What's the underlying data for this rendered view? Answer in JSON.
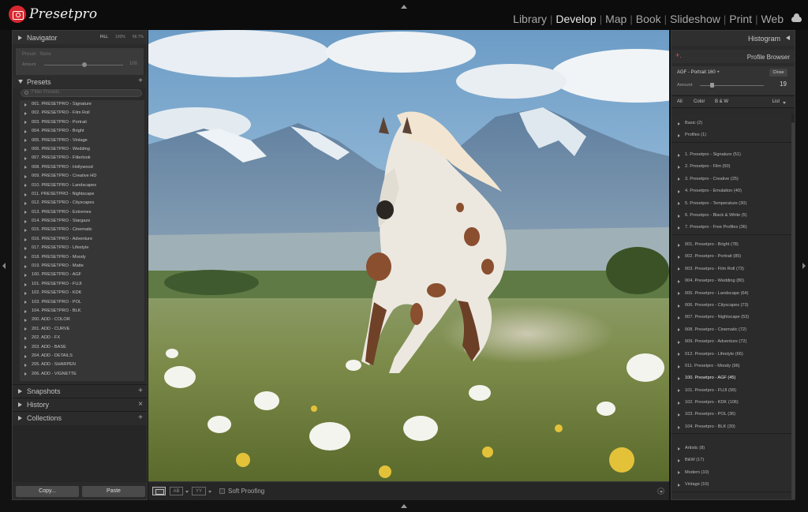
{
  "app": {
    "name": "Presetpro",
    "modules": [
      "Library",
      "Develop",
      "Map",
      "Book",
      "Slideshow",
      "Print",
      "Web"
    ],
    "active_module": "Develop",
    "accent": "#d8282f"
  },
  "navigator": {
    "title": "Navigator",
    "zoom": [
      "FILL",
      "100%",
      "66.7%"
    ],
    "active_zoom": "FILL",
    "preset_text": "Preset : None",
    "amount_label": "Amount",
    "amount_value": "100"
  },
  "presets": {
    "title": "Presets",
    "filter_placeholder": "Filter Presets",
    "items": [
      "001. PRESETPRO - Signature",
      "002. PRESETPRO - Film Roll",
      "003. PRESETPRO - Portrait",
      "004. PRESETPRO - Bright",
      "005. PRESETPRO - Vintage",
      "006. PRESETPRO - Wedding",
      "007. PRESETPRO - Filterlook",
      "008. PRESETPRO - Hollywood",
      "009. PRESETPRO - Creative HD",
      "010. PRESETPRO - Landscapes",
      "011. PRESETPRO - Nightscape",
      "012. PRESETPRO - Cityscapes",
      "013. PRESETPRO - Extremes",
      "014. PRESETPRO - Stargaze",
      "015. PRESETPRO - Cinematic",
      "016. PRESETPRO - Adventure",
      "017. PRESETPRO - Lifestyle",
      "018. PRESETPRO - Moody",
      "019. PRESETPRO - Matte",
      "100. PRESETPRO - AGF",
      "101. PRESETPRO - FUJI",
      "102. PRESETPRO - KDK",
      "103. PRESETPRO - POL",
      "104. PRESETPRO - BLK",
      "200. ADD - COLOR",
      "201. ADD - CURVE",
      "202. ADD - FX",
      "203. ADD - BASE",
      "204. ADD - DETAILS",
      "205. ADD - SHARPEN",
      "206. ADD - VIGNETTE"
    ]
  },
  "left_sections": {
    "snapshots": "Snapshots",
    "history": "History",
    "collections": "Collections",
    "plus": "+",
    "close": "×"
  },
  "buttons": {
    "copy": "Copy...",
    "paste": "Paste"
  },
  "toolbar": {
    "compare_label": "AB",
    "yy_label": "YY",
    "soft_proofing": "Soft Proofing"
  },
  "histogram": {
    "title": "Histogram"
  },
  "profile_browser": {
    "plus": "+.",
    "title": "Profile Browser",
    "current_profile": "AGF - Portrait 160 +",
    "close_label": "Close",
    "amount_label": "Amount",
    "amount_value": "19",
    "amount_fraction": 0.19,
    "filters": {
      "all": "All",
      "color": "Color",
      "bw": "B & W",
      "list": "List"
    },
    "groups": [
      {
        "items": [
          "Basic (2)",
          "Profiles (1)"
        ]
      },
      {
        "items": [
          "1. Presetpro - Signature (51)",
          "2. Presetpro - Film (50)",
          "3. Presetpro - Creative (25)",
          "4. Presetpro - Emulation (40)",
          "5. Presetpro - Temperature (30)",
          "6. Presetpro - Black & White (5)",
          "7. Presetpro - Free Profiles (36)"
        ]
      },
      {
        "items": [
          "001. Presetpro - Bright (78)",
          "002. Presetpro - Portrait (85)",
          "003. Presetpro - Film Roll (73)",
          "004. Presetpro - Wedding (80)",
          "005. Presetpro - Landscape (64)",
          "006. Presetpro - Cityscapes (73)",
          "007. Presetpro - Nightscape (53)",
          "008. Presetpro - Cinematic (72)",
          "009. Presetpro - Adventure (72)",
          "012. Presetpro - Lifestyle (66)",
          "011. Presetpro - Moody (96)",
          "100. Presetpro - AGF (45)",
          "101. Presetpro - FUJI (99)",
          "102. Presetpro - KDK (106)",
          "103. Presetpro - POL (36)",
          "104. Presetpro - BLK (30)"
        ]
      },
      {
        "items": [
          "Artistic (8)",
          "B&W (17)",
          "Modern (10)",
          "Vintage (10)"
        ]
      }
    ],
    "active_item": "100. Presetpro - AGF (45)"
  }
}
